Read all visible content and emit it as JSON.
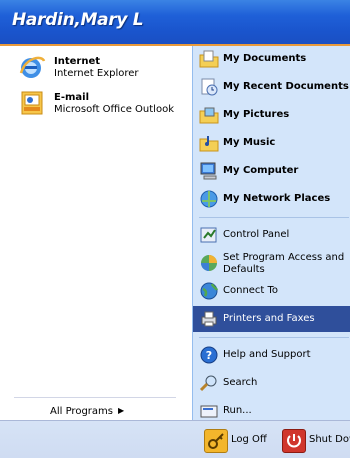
{
  "user": {
    "name": "Hardin,Mary L"
  },
  "left": {
    "pinned": [
      {
        "title": "Internet",
        "subtitle": "Internet Explorer",
        "icon": "internet-explorer-icon"
      },
      {
        "title": "E-mail",
        "subtitle": "Microsoft Office Outlook",
        "icon": "outlook-icon"
      }
    ],
    "all_programs": "All Programs"
  },
  "right": {
    "items": [
      {
        "label": "My Documents",
        "icon": "my-documents-icon"
      },
      {
        "label": "My Recent Documents",
        "icon": "recent-documents-icon"
      },
      {
        "label": "My Pictures",
        "icon": "my-pictures-icon"
      },
      {
        "label": "My Music",
        "icon": "my-music-icon"
      },
      {
        "label": "My Computer",
        "icon": "my-computer-icon"
      },
      {
        "label": "My Network Places",
        "icon": "network-places-icon"
      },
      {
        "label": "Control Panel",
        "icon": "control-panel-icon"
      },
      {
        "label": "Set Program Access and Defaults",
        "label_line1": "Set Program Access and",
        "label_line2": "Defaults",
        "icon": "program-access-icon"
      },
      {
        "label": "Connect To",
        "icon": "connect-to-icon"
      },
      {
        "label": "Printers and Faxes",
        "icon": "printers-faxes-icon",
        "selected": true
      },
      {
        "label": "Help and Support",
        "icon": "help-icon"
      },
      {
        "label": "Search",
        "icon": "search-icon"
      },
      {
        "label": "Run...",
        "icon": "run-icon"
      }
    ]
  },
  "footer": {
    "logoff": "Log Off",
    "shutdown": "Shut Dow"
  },
  "colors": {
    "header": "#1f5ed6",
    "selection": "#2f4f9b",
    "right_panel": "#d3e5fa",
    "header_border": "#e99a3b"
  }
}
